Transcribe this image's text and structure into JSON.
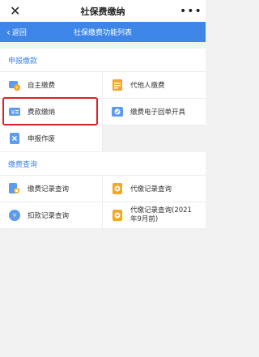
{
  "topbar": {
    "close_glyph": "✕",
    "title": "社保费缴纳",
    "more_glyph": "•••"
  },
  "navbar": {
    "back_label": "返回",
    "title": "社保缴费功能列表"
  },
  "sections": [
    {
      "header": "申报缴款",
      "items": [
        {
          "label": "自主缴费",
          "icon": "coin-hand-icon"
        },
        {
          "label": "代他人缴费",
          "icon": "person-pay-icon"
        },
        {
          "label": "费款缴纳",
          "icon": "yuan-card-icon"
        },
        {
          "label": "缴费电子回单开具",
          "icon": "receipt-check-icon"
        },
        {
          "label": "申报作废",
          "icon": "cancel-doc-icon"
        }
      ]
    },
    {
      "header": "缴费查询",
      "items": [
        {
          "label": "缴费记录查询",
          "icon": "record-search-icon"
        },
        {
          "label": "代缴记录查询",
          "icon": "proxy-record-icon"
        },
        {
          "label": "扣款记录查询",
          "icon": "deduction-record-icon"
        },
        {
          "label": "代缴记录查询(2021年9月前)",
          "icon": "proxy-record-old-icon"
        }
      ]
    }
  ],
  "colors": {
    "accent": "#3d86e8",
    "highlight": "#e02020",
    "icon_orange": "#f5a623",
    "icon_blue": "#5b9cf0"
  }
}
